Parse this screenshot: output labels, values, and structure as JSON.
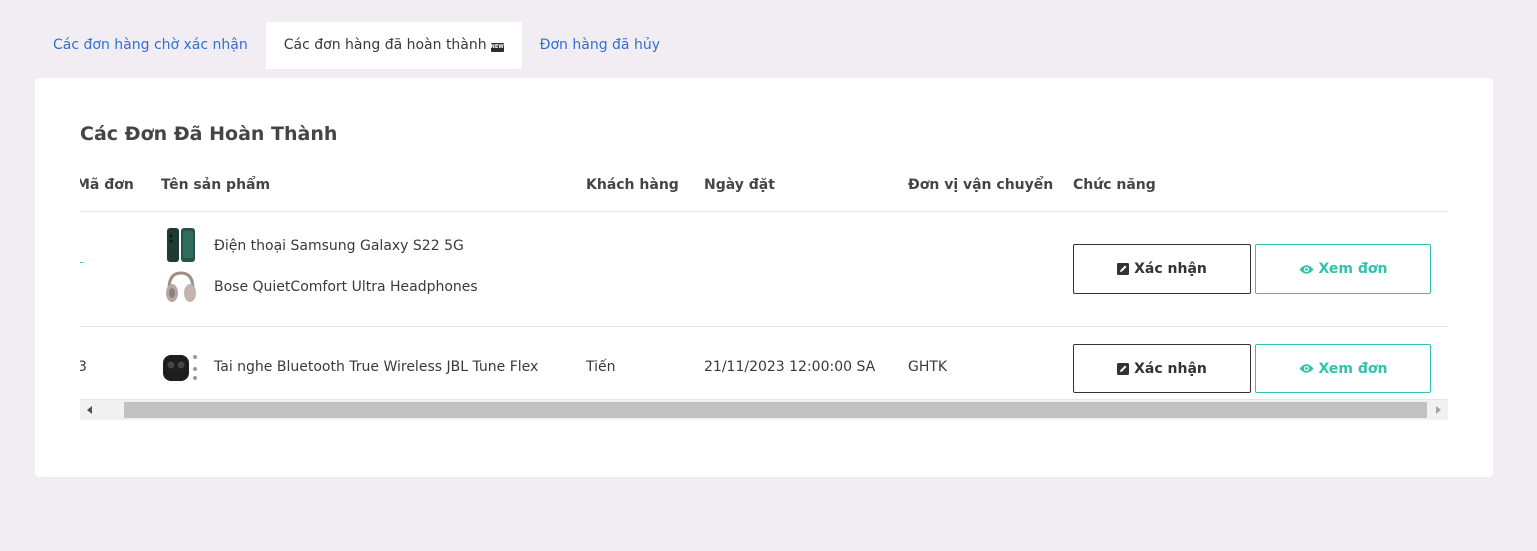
{
  "tabs": [
    {
      "label": "Các đơn hàng chờ xác nhận",
      "active": false
    },
    {
      "label": "Các đơn hàng đã hoàn thành",
      "active": true,
      "badge": "NEW"
    },
    {
      "label": "Đơn hàng đã hủy",
      "active": false
    }
  ],
  "card": {
    "title": "Các Đơn Đã Hoàn Thành"
  },
  "table": {
    "columns": [
      "Mã đơn",
      "Tên sản phẩm",
      "Khách hàng",
      "Ngày đặt",
      "Đơn vị vận chuyển",
      "Chức năng"
    ],
    "rows": [
      {
        "order_id": "",
        "products": [
          "Điện thoại Samsung Galaxy S22 5G",
          "Bose QuietComfort Ultra Headphones"
        ],
        "customer": "",
        "date": "",
        "shipping": "",
        "confirm_label": "Xác nhận",
        "view_label": "Xem đơn"
      },
      {
        "order_id": "3",
        "products": [
          "Tai nghe Bluetooth True Wireless JBL Tune Flex"
        ],
        "customer": "Tiến",
        "date": "21/11/2023 12:00:00 SA",
        "shipping": "GHTK",
        "confirm_label": "Xác nhận",
        "view_label": "Xem đơn"
      }
    ]
  },
  "colors": {
    "background": "#f1edf3",
    "link": "#2f6fd8",
    "accent": "#2fc3ad",
    "dark": "#333333"
  },
  "icons": {
    "confirm": "pen-square-icon",
    "view": "eye-icon",
    "scroll_left": "triangle-left-icon",
    "scroll_right": "triangle-right-icon"
  }
}
